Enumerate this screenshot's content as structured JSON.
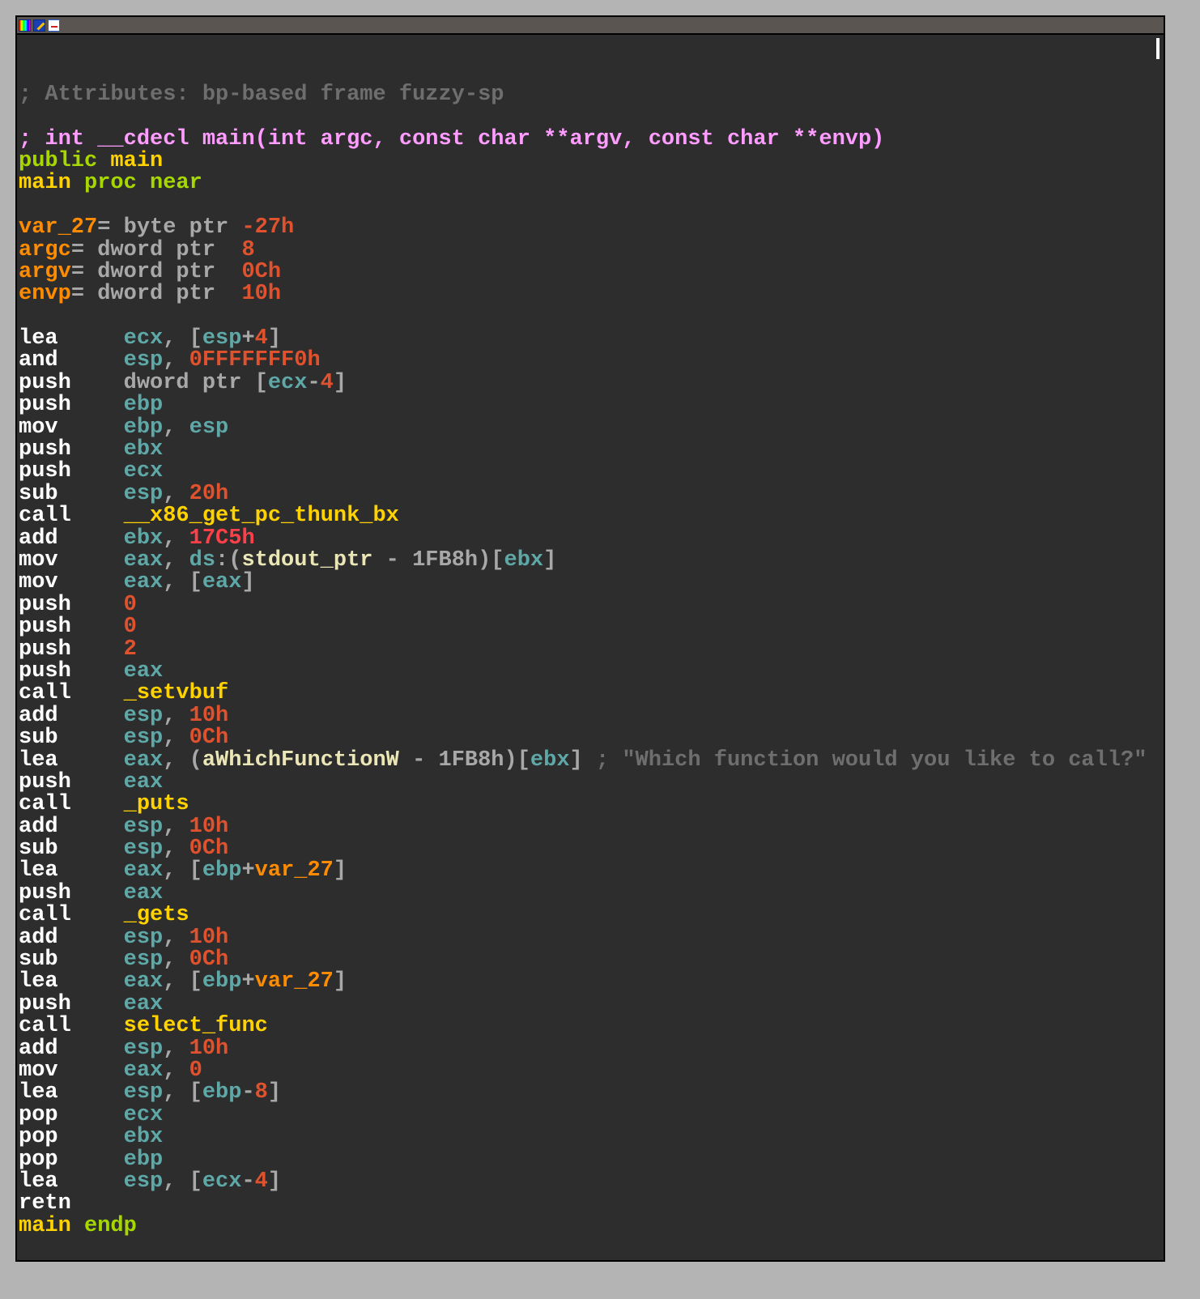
{
  "toolbar": {
    "icons": [
      "palette-icon",
      "edit-icon",
      "graph-view-icon"
    ]
  },
  "colors": {
    "background": "#2d2d2d",
    "mnemonic": "#ffffff",
    "register": "#5fa8a8",
    "number": "#e0522e",
    "function": "#ffd200",
    "comment": "#6e6e6e",
    "signature": "#ff9cff",
    "keyword": "#a6d800",
    "variable": "#ff8c00"
  },
  "lines": [
    [],
    [],
    [
      [
        "c",
        "; Attributes: bp-based frame fuzzy-sp"
      ]
    ],
    [],
    [
      [
        "s",
        "; int __cdecl main(int argc, const char **argv, const char **envp)"
      ]
    ],
    [
      [
        "k",
        "public "
      ],
      [
        "y",
        "main"
      ]
    ],
    [
      [
        "y",
        "main "
      ],
      [
        "k",
        "proc near"
      ]
    ],
    [],
    [
      [
        "v",
        "var_27"
      ],
      [
        "g",
        "= byte ptr "
      ],
      [
        "n",
        "-27h"
      ]
    ],
    [
      [
        "v",
        "argc"
      ],
      [
        "g",
        "= dword ptr  "
      ],
      [
        "n",
        "8"
      ]
    ],
    [
      [
        "v",
        "argv"
      ],
      [
        "g",
        "= dword ptr  "
      ],
      [
        "n",
        "0Ch"
      ]
    ],
    [
      [
        "v",
        "envp"
      ],
      [
        "g",
        "= dword ptr  "
      ],
      [
        "n",
        "10h"
      ]
    ],
    [],
    [
      [
        "m",
        "lea     "
      ],
      [
        "r",
        "ecx"
      ],
      [
        "g",
        ", ["
      ],
      [
        "r",
        "esp"
      ],
      [
        "g",
        "+"
      ],
      [
        "n",
        "4"
      ],
      [
        "g",
        "]"
      ]
    ],
    [
      [
        "m",
        "and     "
      ],
      [
        "r",
        "esp"
      ],
      [
        "g",
        ", "
      ],
      [
        "n",
        "0FFFFFFF0h"
      ]
    ],
    [
      [
        "m",
        "push    "
      ],
      [
        "g",
        "dword ptr ["
      ],
      [
        "r",
        "ecx"
      ],
      [
        "g",
        "-"
      ],
      [
        "n",
        "4"
      ],
      [
        "g",
        "]"
      ]
    ],
    [
      [
        "m",
        "push    "
      ],
      [
        "r",
        "ebp"
      ]
    ],
    [
      [
        "m",
        "mov     "
      ],
      [
        "r",
        "ebp"
      ],
      [
        "g",
        ", "
      ],
      [
        "r",
        "esp"
      ]
    ],
    [
      [
        "m",
        "push    "
      ],
      [
        "r",
        "ebx"
      ]
    ],
    [
      [
        "m",
        "push    "
      ],
      [
        "r",
        "ecx"
      ]
    ],
    [
      [
        "m",
        "sub     "
      ],
      [
        "r",
        "esp"
      ],
      [
        "g",
        ", "
      ],
      [
        "n",
        "20h"
      ]
    ],
    [
      [
        "m",
        "call    "
      ],
      [
        "f",
        "__x86_get_pc_thunk_bx"
      ]
    ],
    [
      [
        "m",
        "add     "
      ],
      [
        "r",
        "ebx"
      ],
      [
        "g",
        ", "
      ],
      [
        "nr",
        "17C5h"
      ]
    ],
    [
      [
        "m",
        "mov     "
      ],
      [
        "r",
        "eax"
      ],
      [
        "g",
        ", "
      ],
      [
        "r",
        "ds"
      ],
      [
        "g",
        ":("
      ],
      [
        "d",
        "stdout_ptr"
      ],
      [
        "g",
        " - 1FB8h)["
      ],
      [
        "r",
        "ebx"
      ],
      [
        "g",
        "]"
      ]
    ],
    [
      [
        "m",
        "mov     "
      ],
      [
        "r",
        "eax"
      ],
      [
        "g",
        ", ["
      ],
      [
        "r",
        "eax"
      ],
      [
        "g",
        "]"
      ]
    ],
    [
      [
        "m",
        "push    "
      ],
      [
        "n",
        "0"
      ]
    ],
    [
      [
        "m",
        "push    "
      ],
      [
        "n",
        "0"
      ]
    ],
    [
      [
        "m",
        "push    "
      ],
      [
        "n",
        "2"
      ]
    ],
    [
      [
        "m",
        "push    "
      ],
      [
        "r",
        "eax"
      ]
    ],
    [
      [
        "m",
        "call    "
      ],
      [
        "f",
        "_setvbuf"
      ]
    ],
    [
      [
        "m",
        "add     "
      ],
      [
        "r",
        "esp"
      ],
      [
        "g",
        ", "
      ],
      [
        "n",
        "10h"
      ]
    ],
    [
      [
        "m",
        "sub     "
      ],
      [
        "r",
        "esp"
      ],
      [
        "g",
        ", "
      ],
      [
        "n",
        "0Ch"
      ]
    ],
    [
      [
        "m",
        "lea     "
      ],
      [
        "r",
        "eax"
      ],
      [
        "g",
        ", ("
      ],
      [
        "d",
        "aWhichFunctionW"
      ],
      [
        "g",
        " - 1FB8h)["
      ],
      [
        "r",
        "ebx"
      ],
      [
        "g",
        "]"
      ],
      [
        "c",
        " ; \"Which function would you like to call?\""
      ]
    ],
    [
      [
        "m",
        "push    "
      ],
      [
        "r",
        "eax"
      ]
    ],
    [
      [
        "m",
        "call    "
      ],
      [
        "f",
        "_puts"
      ]
    ],
    [
      [
        "m",
        "add     "
      ],
      [
        "r",
        "esp"
      ],
      [
        "g",
        ", "
      ],
      [
        "n",
        "10h"
      ]
    ],
    [
      [
        "m",
        "sub     "
      ],
      [
        "r",
        "esp"
      ],
      [
        "g",
        ", "
      ],
      [
        "n",
        "0Ch"
      ]
    ],
    [
      [
        "m",
        "lea     "
      ],
      [
        "r",
        "eax"
      ],
      [
        "g",
        ", ["
      ],
      [
        "r",
        "ebp"
      ],
      [
        "g",
        "+"
      ],
      [
        "v",
        "var_27"
      ],
      [
        "g",
        "]"
      ]
    ],
    [
      [
        "m",
        "push    "
      ],
      [
        "r",
        "eax"
      ]
    ],
    [
      [
        "m",
        "call    "
      ],
      [
        "f",
        "_gets"
      ]
    ],
    [
      [
        "m",
        "add     "
      ],
      [
        "r",
        "esp"
      ],
      [
        "g",
        ", "
      ],
      [
        "n",
        "10h"
      ]
    ],
    [
      [
        "m",
        "sub     "
      ],
      [
        "r",
        "esp"
      ],
      [
        "g",
        ", "
      ],
      [
        "n",
        "0Ch"
      ]
    ],
    [
      [
        "m",
        "lea     "
      ],
      [
        "r",
        "eax"
      ],
      [
        "g",
        ", ["
      ],
      [
        "r",
        "ebp"
      ],
      [
        "g",
        "+"
      ],
      [
        "v",
        "var_27"
      ],
      [
        "g",
        "]"
      ]
    ],
    [
      [
        "m",
        "push    "
      ],
      [
        "r",
        "eax"
      ]
    ],
    [
      [
        "m",
        "call    "
      ],
      [
        "f",
        "select_func"
      ]
    ],
    [
      [
        "m",
        "add     "
      ],
      [
        "r",
        "esp"
      ],
      [
        "g",
        ", "
      ],
      [
        "n",
        "10h"
      ]
    ],
    [
      [
        "m",
        "mov     "
      ],
      [
        "r",
        "eax"
      ],
      [
        "g",
        ", "
      ],
      [
        "n",
        "0"
      ]
    ],
    [
      [
        "m",
        "lea     "
      ],
      [
        "r",
        "esp"
      ],
      [
        "g",
        ", ["
      ],
      [
        "r",
        "ebp"
      ],
      [
        "g",
        "-"
      ],
      [
        "n",
        "8"
      ],
      [
        "g",
        "]"
      ]
    ],
    [
      [
        "m",
        "pop     "
      ],
      [
        "r",
        "ecx"
      ]
    ],
    [
      [
        "m",
        "pop     "
      ],
      [
        "r",
        "ebx"
      ]
    ],
    [
      [
        "m",
        "pop     "
      ],
      [
        "r",
        "ebp"
      ]
    ],
    [
      [
        "m",
        "lea     "
      ],
      [
        "r",
        "esp"
      ],
      [
        "g",
        ", ["
      ],
      [
        "r",
        "ecx"
      ],
      [
        "g",
        "-"
      ],
      [
        "n",
        "4"
      ],
      [
        "g",
        "]"
      ]
    ],
    [
      [
        "m",
        "retn"
      ]
    ],
    [
      [
        "y",
        "main "
      ],
      [
        "k",
        "endp"
      ]
    ]
  ]
}
